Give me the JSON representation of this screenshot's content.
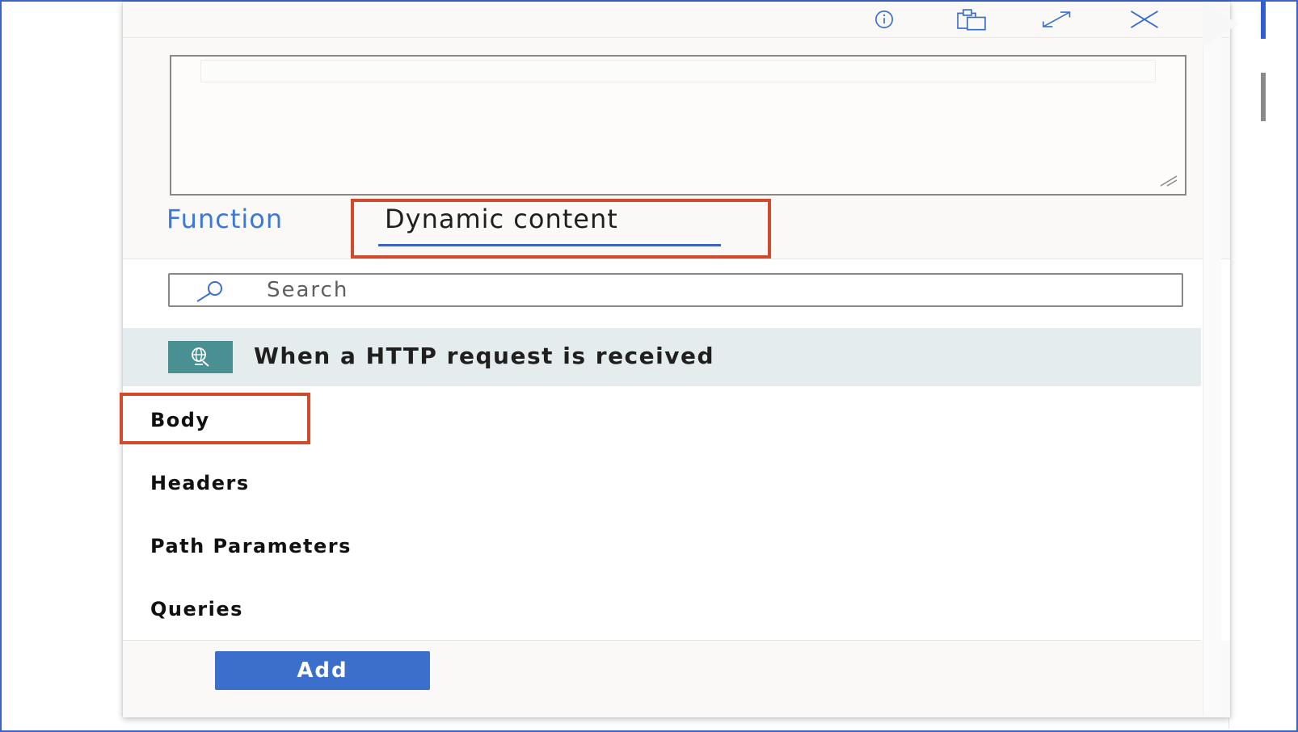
{
  "toolbar": {
    "info_icon": "info-icon",
    "paste_icon": "clipboard-icon",
    "expand_icon": "expand-icon",
    "close_icon": "close-icon"
  },
  "tabs": {
    "function_label": "Function",
    "dynamic_label": "Dynamic content",
    "active": "Dynamic content"
  },
  "search": {
    "placeholder": "Search"
  },
  "group": {
    "title": "When a HTTP request is received",
    "icon": "http-request-icon"
  },
  "items": [
    {
      "label": "Body"
    },
    {
      "label": "Headers"
    },
    {
      "label": "Path Parameters"
    },
    {
      "label": "Queries"
    }
  ],
  "footer": {
    "add_label": "Add"
  },
  "colors": {
    "accent": "#3b6fcb",
    "highlight": "#d24a2c",
    "group_header_bg": "#e4ecee",
    "trigger_icon_bg": "#4a8f92"
  }
}
